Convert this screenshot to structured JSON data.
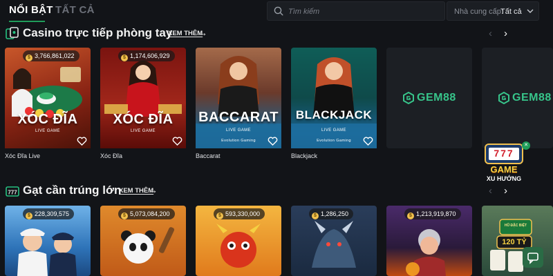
{
  "header": {
    "tab_active": "NỔI BẬT",
    "tab_inactive": "TẤT CẢ",
    "search_placeholder": "Tìm kiếm",
    "provider_label": "Nhà cung cấp:",
    "provider_value": "Tất cả"
  },
  "sections": [
    {
      "title": "Casino trực tiếp phòng tay",
      "see_more": "XEM THÊM",
      "games": [
        {
          "name": "Xóc Đĩa Live",
          "jackpot": "3,766,861,022",
          "art_title": "XÓC ĐĨA",
          "art_sub": "LIVE GAME"
        },
        {
          "name": "Xóc Đĩa",
          "jackpot": "1,174,606,929",
          "art_title": "XÓC ĐĨA",
          "art_sub": "LIVE GAME"
        },
        {
          "name": "Baccarat",
          "art_title": "BACCARAT",
          "art_sub": "LIVE GAME",
          "art_brand": "Evolution Gaming"
        },
        {
          "name": "Blackjack",
          "art_title": "BLACKJACK",
          "art_sub": "LIVE GAME",
          "art_brand": "Evolution Gaming"
        },
        {
          "name": "",
          "art_logo": "GEM88"
        },
        {
          "name": "",
          "art_logo": "GEM88"
        }
      ]
    },
    {
      "title": "Gạt cần trúng lớn",
      "see_more": "XEM THÊM",
      "games": [
        {
          "jackpot": "228,309,575"
        },
        {
          "jackpot": "5,073,084,200"
        },
        {
          "jackpot": "593,330,000"
        },
        {
          "jackpot": "1,286,250"
        },
        {
          "jackpot": "1,213,919,870"
        },
        {
          "art_badge_top": "HŨ ĐẶC BIỆT",
          "art_badge_value": "120 TỶ"
        }
      ]
    }
  ],
  "promo": {
    "title": "GAME",
    "subtitle": "XU HƯỚNG",
    "slot": "777"
  },
  "colors": {
    "background": "#121418",
    "accent": "#1f9d5a",
    "panel": "#1b1e23"
  }
}
